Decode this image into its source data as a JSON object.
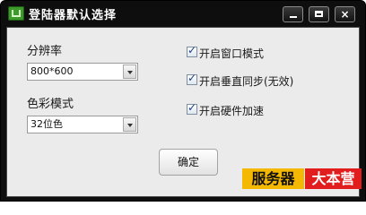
{
  "window": {
    "title": "登陆器默认选择",
    "controls": {
      "minimize": "—",
      "maximize": "□",
      "close": "×"
    }
  },
  "resolution": {
    "label": "分辨率",
    "value": "800*600"
  },
  "color_mode": {
    "label": "色彩模式",
    "value": "32位色"
  },
  "options": [
    {
      "label": "开启窗口模式",
      "checked": true
    },
    {
      "label": "开启垂直同步(无效)",
      "checked": true
    },
    {
      "label": "开启硬件加速",
      "checked": true
    }
  ],
  "confirm_button": "确定",
  "watermark": {
    "left": "服务器",
    "right": "大本营"
  },
  "colors": {
    "titlebar": "#0e0e0e",
    "client": "#ebebeb",
    "check": "#1c3f8a",
    "watermark_left": "#f5b800",
    "watermark_right": "#e11d1d"
  }
}
